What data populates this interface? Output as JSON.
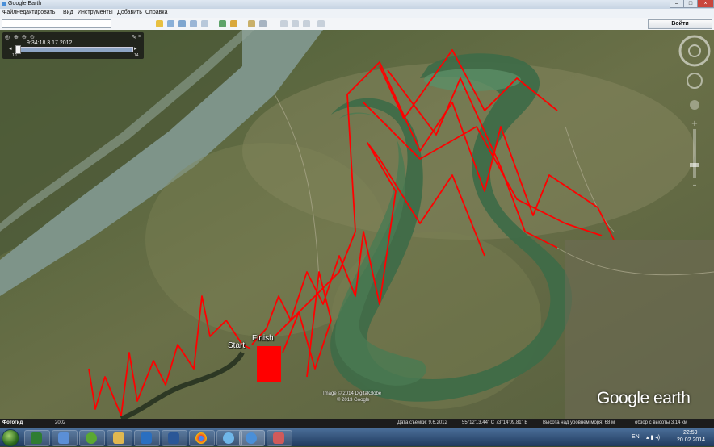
{
  "window": {
    "title": "Google Earth"
  },
  "menu": [
    "Файл",
    "Редактировать",
    "Вид",
    "Инструменты",
    "Добавить",
    "Справка"
  ],
  "toolbar": {
    "search_value": "",
    "go_label": "Войти"
  },
  "tour": {
    "timestamp": "9:34:18 3.17.2012",
    "tick_left": "10",
    "tick_right": "14",
    "slider_position": 0.02
  },
  "map": {
    "labels": {
      "start": "Start",
      "finish": "Finish"
    },
    "imagery_credit_1": "Image © 2014 DigitalGlobe",
    "imagery_credit_2": "© 2013 Google",
    "logo": "Google earth",
    "track_color": "#ff0000"
  },
  "status": {
    "places_label": "Фотогид",
    "year": "2002",
    "date": "Дата съемки: 9.6.2012",
    "coords": "55°12'13.44\" С   73°14'09.81\" В",
    "elev": "Высота над уровнем моря:   68 м",
    "eye": "обзор с высоты   3.14 км"
  },
  "taskbar": {
    "lang": "EN",
    "time": "22:59",
    "date": "20.02.2014"
  }
}
